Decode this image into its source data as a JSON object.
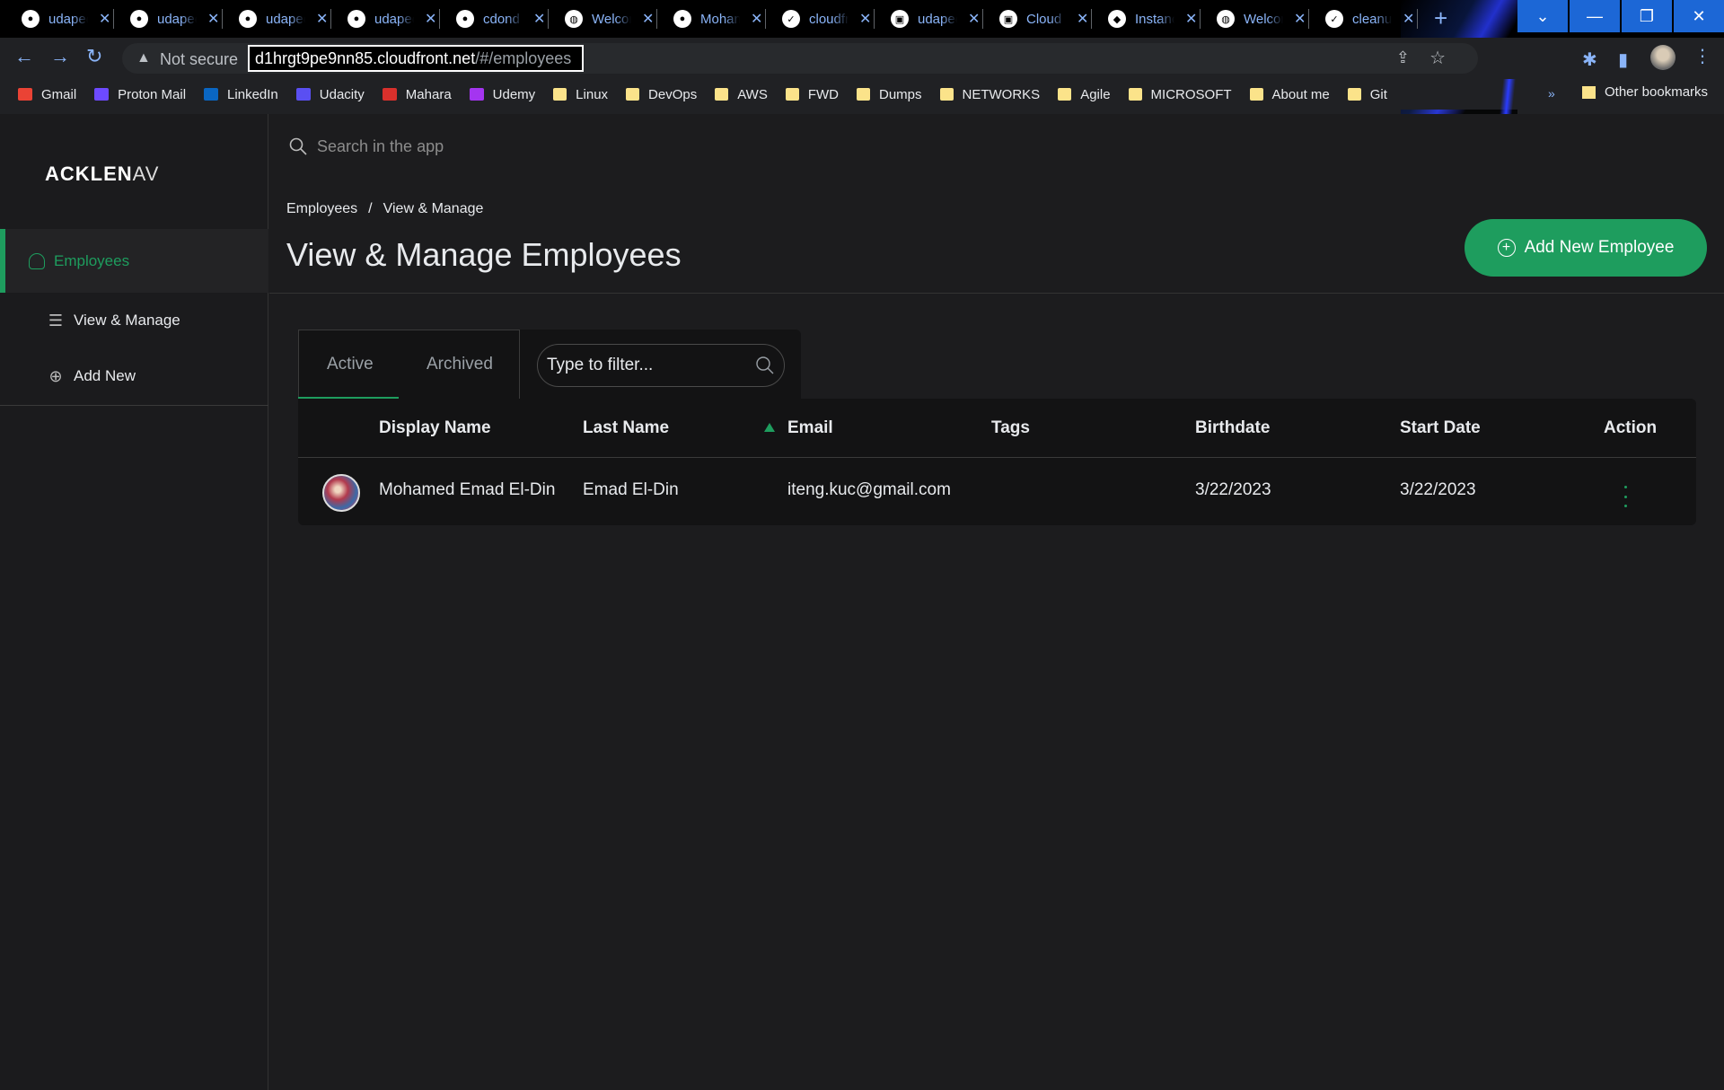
{
  "browser": {
    "tabs": [
      {
        "label": "udapeople",
        "icon": "github-icon"
      },
      {
        "label": "udapeople",
        "icon": "github-icon"
      },
      {
        "label": "udapeople",
        "icon": "github-icon"
      },
      {
        "label": "udapeople",
        "icon": "github-icon"
      },
      {
        "label": "cdond",
        "icon": "github-icon"
      },
      {
        "label": "Welcome",
        "icon": "globe-icon"
      },
      {
        "label": "Mohamed",
        "icon": "github-icon"
      },
      {
        "label": "cloudfront",
        "icon": "check-icon"
      },
      {
        "label": "udapeople",
        "icon": "app-icon"
      },
      {
        "label": "Cloud",
        "icon": "app-icon"
      },
      {
        "label": "Instance",
        "icon": "aws-icon"
      },
      {
        "label": "Welcome",
        "icon": "globe-icon"
      },
      {
        "label": "cleanup",
        "icon": "check-icon"
      }
    ],
    "security_label": "Not secure",
    "url_host": "d1hrgt9pe9nn85.cloudfront.net",
    "url_path": "/#/employees",
    "bookmarks": [
      {
        "label": "Gmail",
        "icon": "gmail-icon",
        "color": "#ea4335"
      },
      {
        "label": "Proton Mail",
        "icon": "protonmail-icon",
        "color": "#6d4aff"
      },
      {
        "label": "LinkedIn",
        "icon": "linkedin-icon",
        "color": "#0a66c2"
      },
      {
        "label": "Udacity",
        "icon": "udacity-icon",
        "color": "#5a4ff2"
      },
      {
        "label": "Mahara",
        "icon": "mahara-icon",
        "color": "#d9302c"
      },
      {
        "label": "Udemy",
        "icon": "udemy-icon",
        "color": "#a435f0"
      },
      {
        "label": "Linux",
        "icon": "folder-icon"
      },
      {
        "label": "DevOps",
        "icon": "folder-icon"
      },
      {
        "label": "AWS",
        "icon": "folder-icon"
      },
      {
        "label": "FWD",
        "icon": "folder-icon"
      },
      {
        "label": "Dumps",
        "icon": "folder-icon"
      },
      {
        "label": "NETWORKS",
        "icon": "folder-icon"
      },
      {
        "label": "Agile",
        "icon": "folder-icon"
      },
      {
        "label": "MICROSOFT",
        "icon": "folder-icon"
      },
      {
        "label": "About me",
        "icon": "folder-icon"
      },
      {
        "label": "Git",
        "icon": "folder-icon"
      }
    ],
    "bookmarks_more": "»",
    "other_bookmarks": "Other bookmarks"
  },
  "app": {
    "logo_bold": "ACKLEN",
    "logo_thin": "AV",
    "sidebar": {
      "section": "Employees",
      "items": [
        {
          "label": "View & Manage",
          "icon": "list-icon"
        },
        {
          "label": "Add New",
          "icon": "plus-circle-icon"
        }
      ]
    },
    "search_placeholder": "Search in the app",
    "breadcrumb": [
      "Employees",
      "View & Manage"
    ],
    "breadcrumb_sep": "/",
    "page_title": "View & Manage Employees",
    "add_button": "Add New Employee",
    "tabs": [
      "Active",
      "Archived"
    ],
    "active_tab": "Active",
    "filter_placeholder": "Type to filter...",
    "table": {
      "columns": [
        "Display Name",
        "Last Name",
        "Email",
        "Tags",
        "Birthdate",
        "Start Date",
        "Action"
      ],
      "sorted_column": "Email",
      "rows": [
        {
          "display_name": "Mohamed Emad El-Din",
          "last_name": "Emad El-Din",
          "email": "iteng.kuc@gmail.com",
          "tags": "",
          "birthdate": "3/22/2023",
          "start_date": "3/22/2023"
        }
      ]
    },
    "accent_color": "#1e9d5e"
  }
}
